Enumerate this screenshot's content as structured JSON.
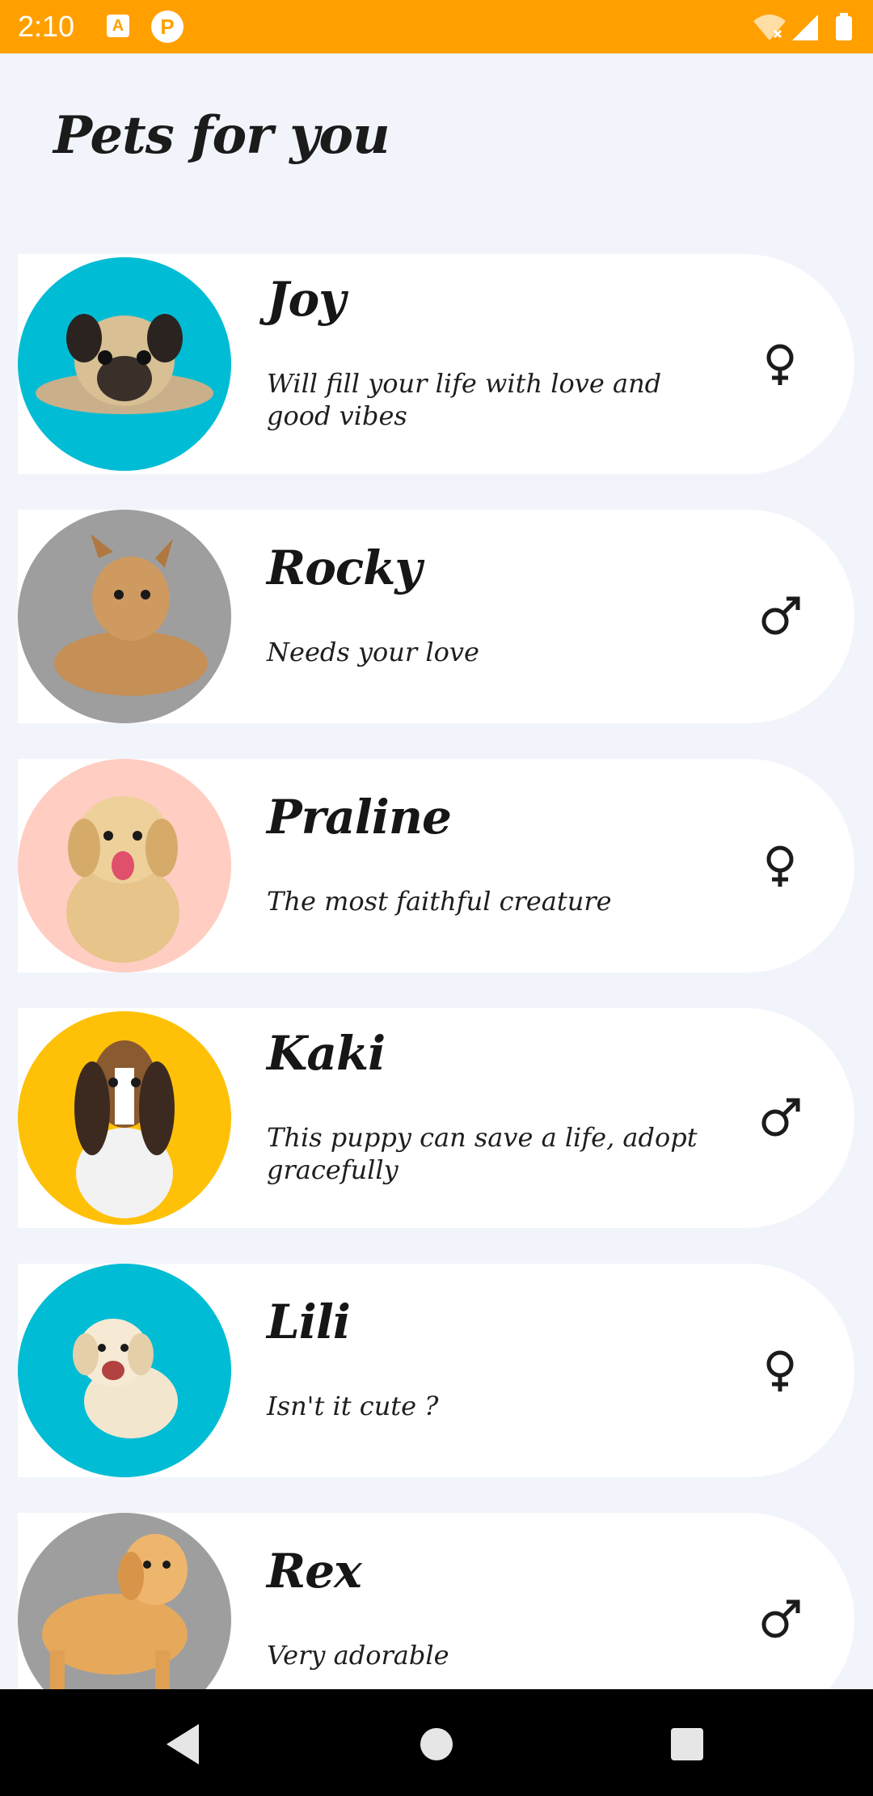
{
  "status_bar": {
    "time": "2:10",
    "icons": [
      "app-a-icon",
      "app-p-icon",
      "wifi-icon",
      "signal-icon",
      "battery-icon"
    ],
    "color": "#FFA000"
  },
  "header": {
    "title": "Pets for you"
  },
  "pets": [
    {
      "name": "Joy",
      "description": "Will fill your life with love and good vibes",
      "gender": "female",
      "gender_icon": "female-icon",
      "avatar_color": "#00BCD4",
      "breed_image": "pug"
    },
    {
      "name": "Rocky",
      "description": "Needs your love",
      "gender": "male",
      "gender_icon": "male-icon",
      "avatar_color": "#9E9E9E",
      "breed_image": "tan-mixed-dog"
    },
    {
      "name": "Praline",
      "description": "The most faithful creature",
      "gender": "female",
      "gender_icon": "female-icon",
      "avatar_color": "#FFCDC2",
      "breed_image": "golden-puppy"
    },
    {
      "name": "Kaki",
      "description": "This puppy can save a life, adopt gracefully",
      "gender": "male",
      "gender_icon": "male-icon",
      "avatar_color": "#FFC107",
      "breed_image": "basset-hound"
    },
    {
      "name": "Lili",
      "description": "Isn't it cute ?",
      "gender": "female",
      "gender_icon": "female-icon",
      "avatar_color": "#00BCD4",
      "breed_image": "white-puppy"
    },
    {
      "name": "Rex",
      "description": "Very adorable",
      "gender": "male",
      "gender_icon": "male-icon",
      "avatar_color": "#9E9E9E",
      "breed_image": "golden-retriever"
    }
  ],
  "nav_bar": {
    "back": "back-icon",
    "home": "home-icon",
    "recents": "recents-icon"
  }
}
